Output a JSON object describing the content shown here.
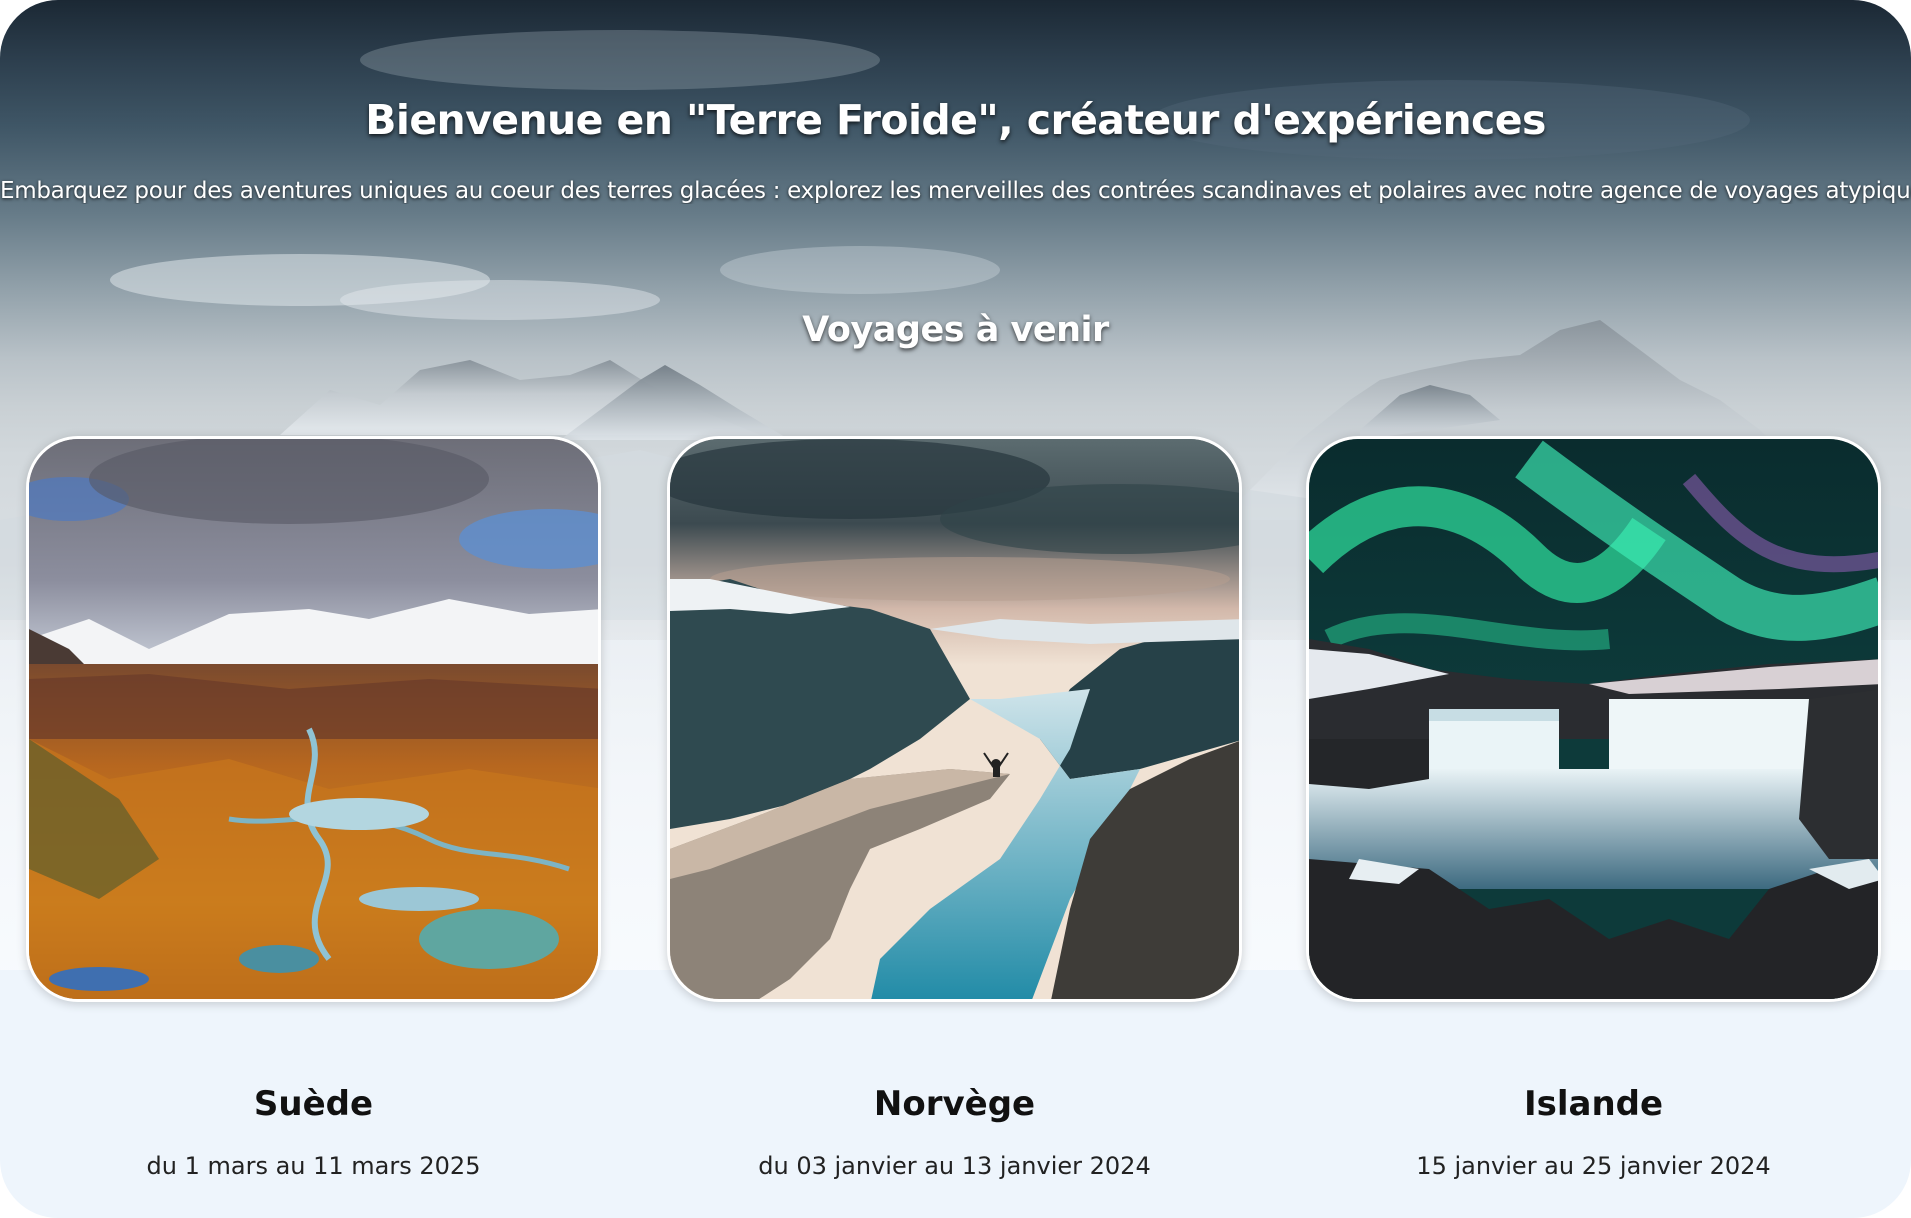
{
  "hero": {
    "title": "Bienvenue en \"Terre Froide\", créateur d'expériences",
    "subtitle": "Embarquez pour des aventures uniques au coeur des terres glacées : explorez les merveilles des contrées scandinaves et polaires avec notre agence de voyages atypique."
  },
  "trips_section": {
    "title": "Voyages à venir",
    "trips": [
      {
        "name": "Suède",
        "dates": "du 1 mars au 11 mars 2025",
        "image_icon": "sweden-valley-photo"
      },
      {
        "name": "Norvège",
        "dates": "du 03 janvier au 13 janvier 2024",
        "image_icon": "norway-fjord-photo"
      },
      {
        "name": "Islande",
        "dates": "15 janvier au 25 janvier 2024",
        "image_icon": "iceland-aurora-waterfall-photo"
      }
    ]
  },
  "colors": {
    "page_background": "#eef5fc",
    "heading_text": "#ffffff",
    "card_text": "#111111"
  }
}
